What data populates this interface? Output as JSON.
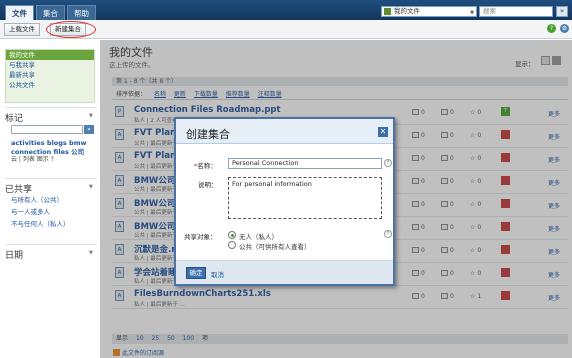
{
  "top_nav": {
    "tabs": [
      "文件",
      "集合",
      "帮助"
    ],
    "scope_label": "我的文件",
    "search_placeholder": "搜索",
    "search_button": "»"
  },
  "toolbar": {
    "upload_label": "上载文件",
    "new_collection_label": "新建集合",
    "help_icon": "?",
    "settings_icon": "⚙"
  },
  "sidebar": {
    "nav_items": [
      "我的文件",
      "与我共享",
      "最新共享",
      "公共文件"
    ],
    "tags_heading": "标记",
    "tags_line1": "activities blogs bmw",
    "tags_line2": "connection files 公司",
    "tag_controls": "云 | 列表  图示  ?",
    "tag_go": "»",
    "shared_heading": "已共享",
    "shared_items": [
      "与所有人（公共）",
      "与一人或多人",
      "不与任何人（私人）"
    ],
    "date_heading": "日期"
  },
  "main": {
    "title": "我的文件",
    "subtitle": "这上传的文件。",
    "display_label": "显示：",
    "pager_top": "第 1 - 8 个（共 8 个）",
    "sort_label": "排序依据：",
    "sort_options": [
      "名称",
      "更新",
      "下载数量",
      "推荐数量",
      "注释数量"
    ],
    "files": [
      {
        "icon": "P",
        "name": "Connection Files Roadmap.ppt",
        "meta": "私人  | 2 人可查看  | 最后更新于 ...",
        "downloads": "0",
        "comments": "0",
        "recs": "0",
        "more": "更多",
        "flag": "T",
        "flag_color": "#4aa02c"
      },
      {
        "icon": "A",
        "name": "FVT Plan f",
        "meta": "公共  | 最后更新于 ...",
        "downloads": "0",
        "comments": "0",
        "recs": "0",
        "more": "更多",
        "flag": "",
        "flag_color": "#c93a3a"
      },
      {
        "icon": "A",
        "name": "FVT Plan f",
        "meta": "公共  | 最后更新于 ...",
        "downloads": "0",
        "comments": "0",
        "recs": "0",
        "more": "更多",
        "flag": "",
        "flag_color": "#c93a3a"
      },
      {
        "icon": "A",
        "name": "BMW公司",
        "meta": "公共  | 最后更新于 ...",
        "downloads": "0",
        "comments": "0",
        "recs": "0",
        "more": "更多",
        "flag": "",
        "flag_color": "#c93a3a"
      },
      {
        "icon": "A",
        "name": "BMW公司",
        "meta": "公共  | 最后更新于 ...",
        "downloads": "0",
        "comments": "0",
        "recs": "0",
        "more": "更多",
        "flag": "",
        "flag_color": "#c93a3a"
      },
      {
        "icon": "A",
        "name": "BMW公司",
        "meta": "公共  | 最后更新于 ...",
        "downloads": "0",
        "comments": "0",
        "recs": "0",
        "more": "更多",
        "flag": "",
        "flag_color": "#c93a3a"
      },
      {
        "icon": "A",
        "name": "沉默是金.r",
        "meta": "私人  | 最后更新于 ...",
        "downloads": "0",
        "comments": "0",
        "recs": "0",
        "more": "更多",
        "flag": "",
        "flag_color": "#c93a3a"
      },
      {
        "icon": "A",
        "name": "学会站着睡觉.doc",
        "meta": "私人  | 最后更新于 上午 10:17",
        "downloads": "0",
        "comments": "0",
        "recs": "0",
        "more": "更多",
        "flag": "",
        "flag_color": "#c93a3a"
      },
      {
        "icon": "A",
        "name": "FilesBurndownCharts251.xls",
        "meta": "私人  | 最后更新于 ...",
        "downloads": "0",
        "comments": "0",
        "recs": "1",
        "more": "更多",
        "flag": "",
        "flag_color": "#c93a3a"
      }
    ],
    "pager_bottom": [
      "显示",
      "10",
      "25",
      "50",
      "100",
      "项"
    ],
    "rss_label": "此文件的订阅源"
  },
  "dialog": {
    "title": "创建集合",
    "close_icon": "✕",
    "name_label": "名称：",
    "name_value": "Personal Connection",
    "desc_label": "说明：",
    "desc_value": "For personal information",
    "share_label": "共享对象：",
    "option_none": "无人（私人）",
    "option_public": "公共（可供所有人查看）",
    "help_icon": "?",
    "ok_label": "确定",
    "cancel_label": "取消"
  }
}
